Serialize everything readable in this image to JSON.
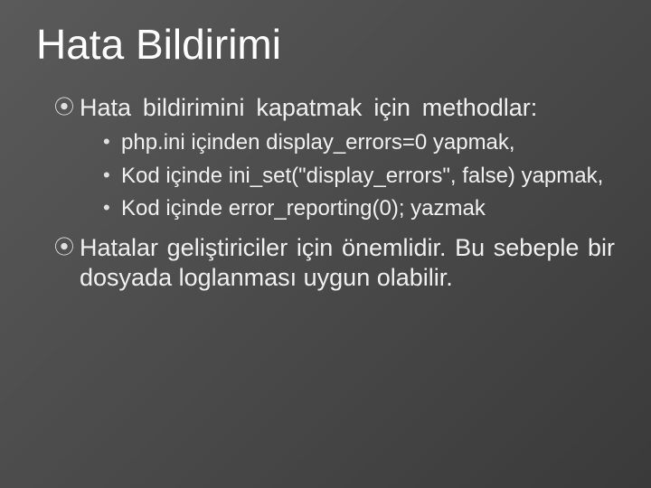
{
  "slide": {
    "title": "Hata Bildirimi",
    "bullets": [
      {
        "text": "Hata bildirimini kapatmak için methodlar:",
        "sub": [
          "php.ini içinden display_errors=0 yapmak,",
          "Kod içinde ini_set(\"display_errors\", false) yapmak,",
          "Kod içinde error_reporting(0); yazmak"
        ]
      },
      {
        "text": "Hatalar geliştiriciler için önemlidir. Bu sebeple bir dosyada loglanması uygun olabilir.",
        "sub": []
      }
    ]
  }
}
